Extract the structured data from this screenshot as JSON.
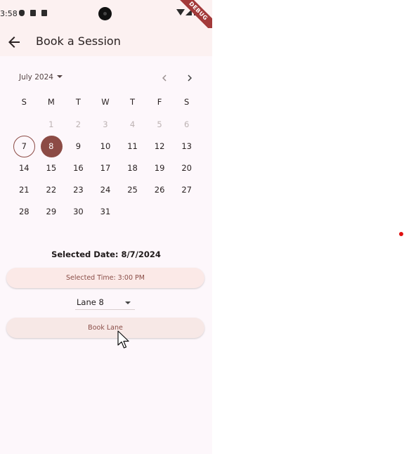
{
  "status_bar": {
    "time": "3:58"
  },
  "debug_banner": "DEBUG",
  "app_bar": {
    "title": "Book a Session"
  },
  "calendar": {
    "month_label": "July 2024",
    "weekdays": [
      "S",
      "M",
      "T",
      "W",
      "T",
      "F",
      "S"
    ],
    "weeks": [
      [
        "",
        "1",
        "2",
        "3",
        "4",
        "5",
        "6"
      ],
      [
        "7",
        "8",
        "9",
        "10",
        "11",
        "12",
        "13"
      ],
      [
        "14",
        "15",
        "16",
        "17",
        "18",
        "19",
        "20"
      ],
      [
        "21",
        "22",
        "23",
        "24",
        "25",
        "26",
        "27"
      ],
      [
        "28",
        "29",
        "30",
        "31",
        "",
        "",
        ""
      ]
    ],
    "today": "7",
    "selected": "8",
    "accent_color": "#8c4b45"
  },
  "details": {
    "selected_date": "Selected Date: 8/7/2024",
    "selected_time_button": "Selected Time: 3:00 PM",
    "lane_value": "Lane 8",
    "book_button": "Book Lane"
  }
}
